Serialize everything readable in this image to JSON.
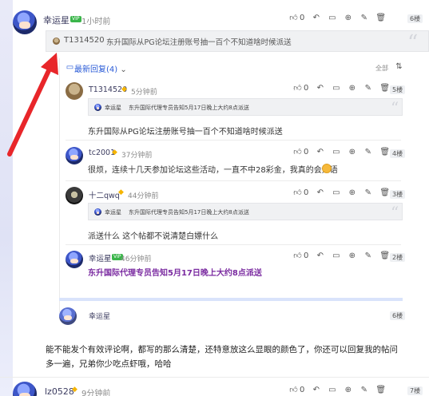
{
  "main_comment": {
    "author": "幸运星",
    "badge": "VIP",
    "time": "1小时前",
    "like_count": "0",
    "floor": "6楼",
    "quote_author": "T1314520",
    "quote_text": "东升国际从PG论坛注册账号抽一百个不知道啥时候派送"
  },
  "replies_header": {
    "label": "最新回复",
    "count": "(4)",
    "expand_label": "全部"
  },
  "replies": [
    {
      "author": "T1314520",
      "time": "5分钟前",
      "like_count": "0",
      "floor": "5楼",
      "quote_author": "幸运星",
      "quote_text": "东升国际代理专员告知5月17日晚上大约8点派送",
      "text": "东升国际从PG论坛注册账号抽一百个不知道啥时候派送"
    },
    {
      "author": "tc2001",
      "time": "37分钟前",
      "like_count": "0",
      "floor": "4楼",
      "text": "很烦，连续十几天参加论坛这些活动，一直不中28彩金，我真的会无语"
    },
    {
      "author": "十二qwq",
      "time": "44分钟前",
      "like_count": "0",
      "floor": "3楼",
      "quote_author": "幸运星",
      "quote_text": "东升国际代理专员告知5月17日晚上大约8点派送",
      "text": "派送什么 这个帖都不说清楚白嫖什么"
    },
    {
      "author": "幸运星",
      "badge": "VIP",
      "time": "46分钟前",
      "like_count": "0",
      "floor": "2楼",
      "text": "东升国际代理专员告知5月17日晚上大约8点派送"
    }
  ],
  "reply_tail": {
    "author": "幸运星",
    "floor": "6楼"
  },
  "commentary": {
    "line1": "能不能发个有效评论啊，都写的那么清楚，还特意放这么显眼的颜色了，你还可以回复我的帖问",
    "line2": "多一遍，兄弟你少吃点虾哦，哈哈"
  },
  "bottom_comment": {
    "author": "lz0528",
    "time": "9分钟前",
    "like_count": "0",
    "floor": "7楼"
  },
  "colors": {
    "arrow": "#e8262a",
    "link_blue": "#2a5bd7",
    "highlight_purple": "#7a2aa0",
    "vip_green": "#3ab54a"
  },
  "icons": [
    "thumbs-up-icon",
    "reply-arrow-icon",
    "comment-icon",
    "plus-circle-icon",
    "edit-icon",
    "trash-icon",
    "sort-icon",
    "chevron-down-icon"
  ]
}
